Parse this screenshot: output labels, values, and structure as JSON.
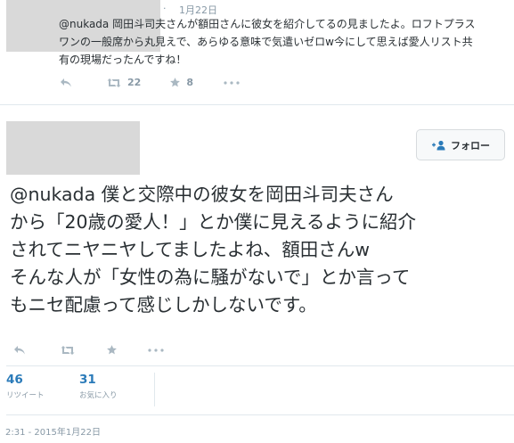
{
  "reply": {
    "separator": "·",
    "date": "1月22日",
    "text_lines": [
      "@nukada 岡田斗司夫さんが額田さんに彼女を紹介してるの見ましたよ。ロフトプラス",
      "ワンの一般席から丸見えで、あらゆる意味で気遣いゼロw今にして思えば愛人リスト共",
      "有の現場だったんですね！"
    ],
    "actions": {
      "reply_icon": "reply-icon",
      "retweet_icon": "retweet-icon",
      "retweet_count": "22",
      "favorite_icon": "star-icon",
      "favorite_count": "8",
      "more_icon": "more-icon"
    }
  },
  "main": {
    "follow_button": {
      "icon": "follow-person-icon",
      "label": "フォロー"
    },
    "text_lines": [
      "@nukada 僕と交際中の彼女を岡田斗司夫さん",
      "から「20歳の愛人！」とか僕に見えるように紹介",
      "されてニヤニヤしてましたよね、額田さんw",
      "そんな人が「女性の為に騒がないで」とか言って",
      "もニセ配慮って感じしかしないです。"
    ],
    "actions": {
      "reply_icon": "reply-icon",
      "retweet_icon": "retweet-icon",
      "favorite_icon": "star-icon",
      "more_icon": "more-icon"
    },
    "stats": {
      "retweets": {
        "value": "46",
        "label": "リツイート"
      },
      "favorites": {
        "value": "31",
        "label": "お気に入り"
      }
    },
    "timestamp": "2:31 - 2015年1月22日"
  },
  "colors": {
    "text": "#292f33",
    "muted": "#8899a6",
    "icon": "#aab8c2",
    "link": "#2b7bb9",
    "divider": "#e1e8ed"
  }
}
